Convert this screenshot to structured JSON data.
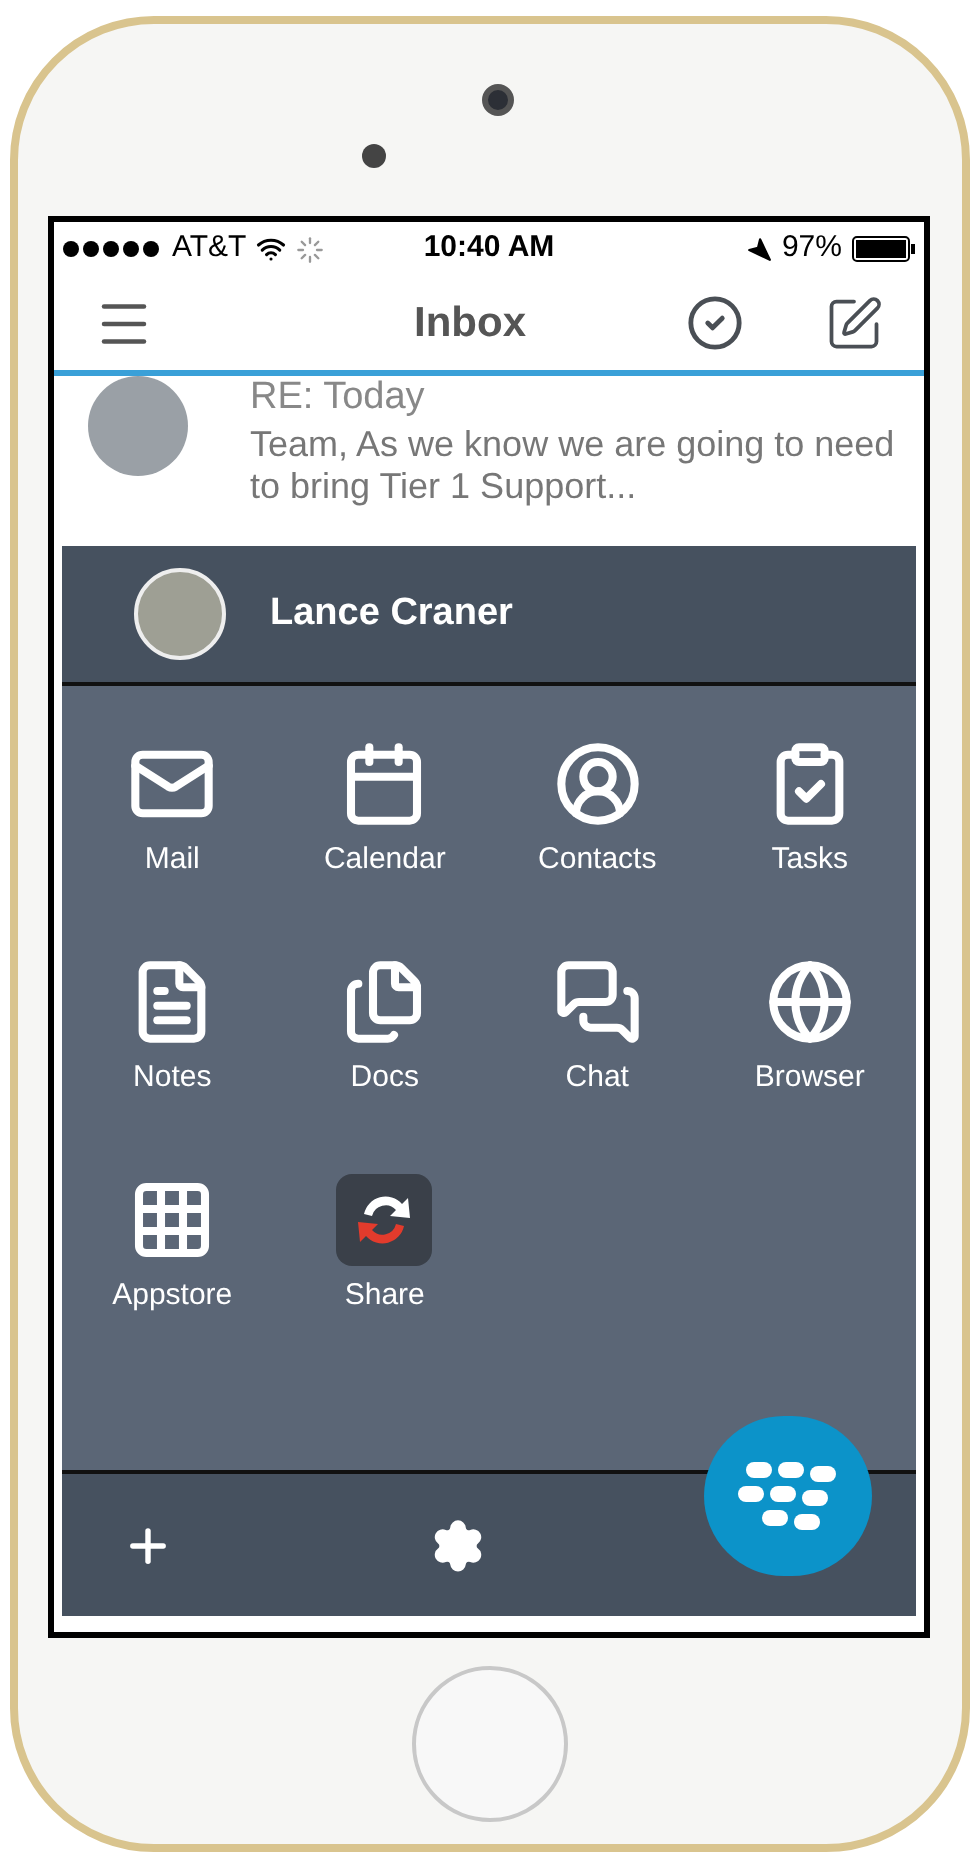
{
  "status_bar": {
    "carrier": "AT&T",
    "time": "10:40 AM",
    "battery": "97%"
  },
  "header": {
    "title": "Inbox"
  },
  "message": {
    "subject": "RE: Today",
    "preview": "Team, As we know we are going to need to bring Tier 1 Support..."
  },
  "drawer": {
    "user_name": "Lance Craner",
    "apps": [
      {
        "label": "Mail",
        "kind": "icon"
      },
      {
        "label": "Calendar",
        "kind": "icon"
      },
      {
        "label": "Contacts",
        "kind": "icon"
      },
      {
        "label": "Tasks",
        "kind": "icon"
      },
      {
        "label": "Notes",
        "kind": "icon"
      },
      {
        "label": "Docs",
        "kind": "icon"
      },
      {
        "label": "Chat",
        "kind": "icon"
      },
      {
        "label": "Browser",
        "kind": "icon"
      },
      {
        "label": "Appstore",
        "kind": "icon"
      },
      {
        "label": "Share",
        "kind": "tile"
      }
    ]
  }
}
